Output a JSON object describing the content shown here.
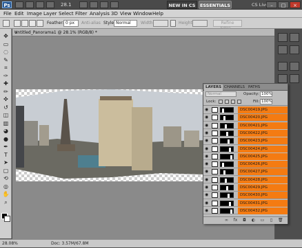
{
  "app": {
    "logo_text": "Ps",
    "zoom_level": "28.1",
    "new_in_label": "NEW IN CS 5",
    "workspace_label": "ESSENTIALS",
    "cs_live_label": "CS Live"
  },
  "window_controls": {
    "minimize": "–",
    "maximize": "□",
    "close": "×"
  },
  "menu": [
    "File",
    "Edit",
    "Image",
    "Layer",
    "Select",
    "Filter",
    "Analysis",
    "3D",
    "View",
    "Window",
    "Help"
  ],
  "options": {
    "feather_label": "Feather:",
    "feather_value": "0 px",
    "antialias_label": "Anti-alias",
    "style_label": "Style:",
    "style_value": "Normal",
    "width_label": "Width:",
    "height_label": "Height:",
    "refine_edge_label": "Refine Edge..."
  },
  "document": {
    "tab_title": "Untitled_Panorama1 @ 28.1% (RGB/8) *",
    "close_glyph": "×"
  },
  "statusbar": {
    "zoom": "28.08%",
    "doc_info": "Doc: 3.57M/67.8M"
  },
  "layers_panel": {
    "tabs": [
      "LAYERS",
      "CHANNELS",
      "PATHS"
    ],
    "blend_mode": "Normal",
    "opacity_label": "Opacity:",
    "opacity_value": "100%",
    "lock_label": "Lock:",
    "fill_label": "Fill:",
    "fill_value": "100%",
    "layers": [
      {
        "name": "DSC00419.JPG",
        "highlight": "#f47b12"
      },
      {
        "name": "DSC00420.JPG",
        "highlight": "#f47b12"
      },
      {
        "name": "DSC00421.JPG",
        "highlight": "#f47b12"
      },
      {
        "name": "DSC00422.JPG",
        "highlight": "#f47b12"
      },
      {
        "name": "DSC00423.JPG",
        "highlight": "#f47b12"
      },
      {
        "name": "DSC00424.JPG",
        "highlight": "#f47b12"
      },
      {
        "name": "DSC00425.JPG",
        "highlight": "#f47b12"
      },
      {
        "name": "DSC00426.JPG",
        "highlight": "#f47b12"
      },
      {
        "name": "DSC00427.JPG",
        "highlight": "#f47b12"
      },
      {
        "name": "DSC00428.JPG",
        "highlight": "#f47b12"
      },
      {
        "name": "DSC00429.JPG",
        "highlight": "#f47b12"
      },
      {
        "name": "DSC00430.JPG",
        "highlight": "#f47b12"
      },
      {
        "name": "DSC00431.JPG",
        "highlight": "#f47b12"
      },
      {
        "name": "DSC00432.JPG",
        "highlight": "#f47b12"
      }
    ],
    "footer_icons": [
      "link-icon",
      "fx-icon",
      "mask-icon",
      "adjustment-icon",
      "folder-icon",
      "new-layer-icon",
      "trash-icon"
    ]
  },
  "tools": [
    "move-tool-icon",
    "marquee-tool-icon",
    "lasso-tool-icon",
    "quick-select-tool-icon",
    "crop-tool-icon",
    "eyedropper-tool-icon",
    "healing-tool-icon",
    "brush-tool-icon",
    "clone-stamp-tool-icon",
    "history-brush-tool-icon",
    "eraser-tool-icon",
    "gradient-tool-icon",
    "blur-tool-icon",
    "dodge-tool-icon",
    "pen-tool-icon",
    "type-tool-icon",
    "path-select-tool-icon",
    "shape-tool-icon",
    "3d-rotate-tool-icon",
    "3d-orbit-tool-icon",
    "hand-tool-icon",
    "zoom-tool-icon"
  ]
}
